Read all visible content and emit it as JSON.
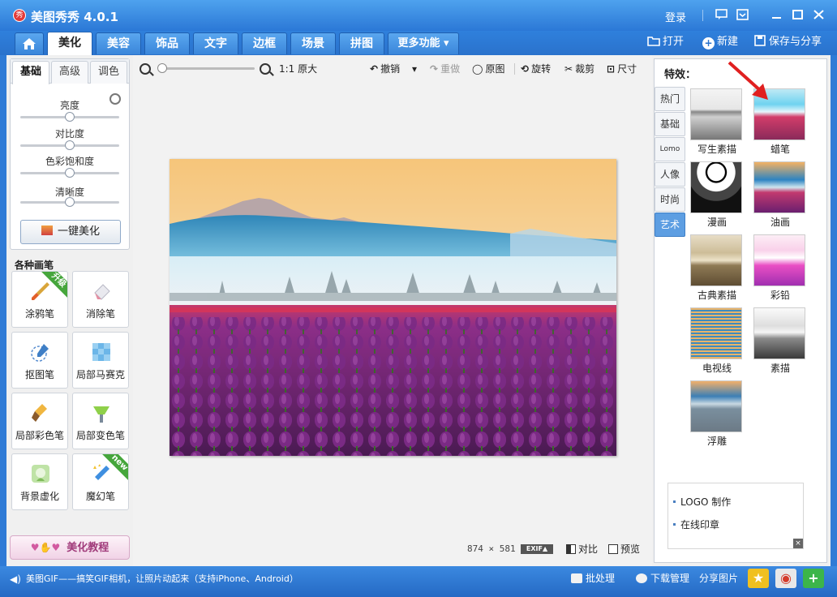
{
  "window": {
    "logo_text": "秀",
    "title": "美图秀秀 4.0.1",
    "login": "登录"
  },
  "main_tabs": [
    {
      "label": "美化",
      "active": true
    },
    {
      "label": "美容"
    },
    {
      "label": "饰品"
    },
    {
      "label": "文字"
    },
    {
      "label": "边框"
    },
    {
      "label": "场景"
    },
    {
      "label": "拼图"
    },
    {
      "label": "更多功能 ▾"
    }
  ],
  "top_actions": {
    "open": "打开",
    "new": "新建",
    "save_share": "保存与分享"
  },
  "left": {
    "subtabs": [
      "基础",
      "高级",
      "调色"
    ],
    "sliders": [
      "亮度",
      "对比度",
      "色彩饱和度",
      "清晰度"
    ],
    "slider_levels": [
      0.5,
      0.5,
      0.5,
      0.5
    ],
    "one_click": "一键美化",
    "brushes_title": "各种画笔",
    "brushes": [
      {
        "label": "涂鸦笔",
        "badge": "升级"
      },
      {
        "label": "消除笔"
      },
      {
        "label": "抠图笔"
      },
      {
        "label": "局部马赛克"
      },
      {
        "label": "局部彩色笔"
      },
      {
        "label": "局部变色笔"
      },
      {
        "label": "背景虚化"
      },
      {
        "label": "魔幻笔",
        "badge": "new"
      }
    ],
    "tutorial": "美化教程"
  },
  "toolbar": {
    "original_size": "1:1 原大",
    "undo": "撤销",
    "redo": "重做",
    "original": "原图",
    "rotate": "旋转",
    "crop": "裁剪",
    "size": "尺寸"
  },
  "canvas": {
    "width_value": "874",
    "times": "×",
    "height_value": "581",
    "exif": "EXIF▲",
    "compare": "对比",
    "preview": "预览"
  },
  "right": {
    "effects_title": "特效：",
    "side_tabs": [
      {
        "label": "热门"
      },
      {
        "label": "基础"
      },
      {
        "label": "Lomo"
      },
      {
        "label": "人像"
      },
      {
        "label": "时尚"
      },
      {
        "label": "艺术",
        "active": true
      }
    ],
    "effects": [
      "写生素描",
      "蜡笔",
      "漫画",
      "油画",
      "古典素描",
      "彩铅",
      "电视线",
      "素描",
      "浮雕"
    ],
    "ad_items": [
      "LOGO 制作",
      "在线印章"
    ]
  },
  "statusbar": {
    "marquee": "美图GIF——搞笑GIF相机，让照片动起来（支持iPhone、Android）",
    "batch": "批处理",
    "download_mgr": "下载管理",
    "share_photo": "分享图片"
  },
  "colors": {
    "title_bar": "#2b78d6",
    "active_side_tab": "#5d9ee2",
    "arrow": "#e02020",
    "tulip": "#7a2a84"
  }
}
